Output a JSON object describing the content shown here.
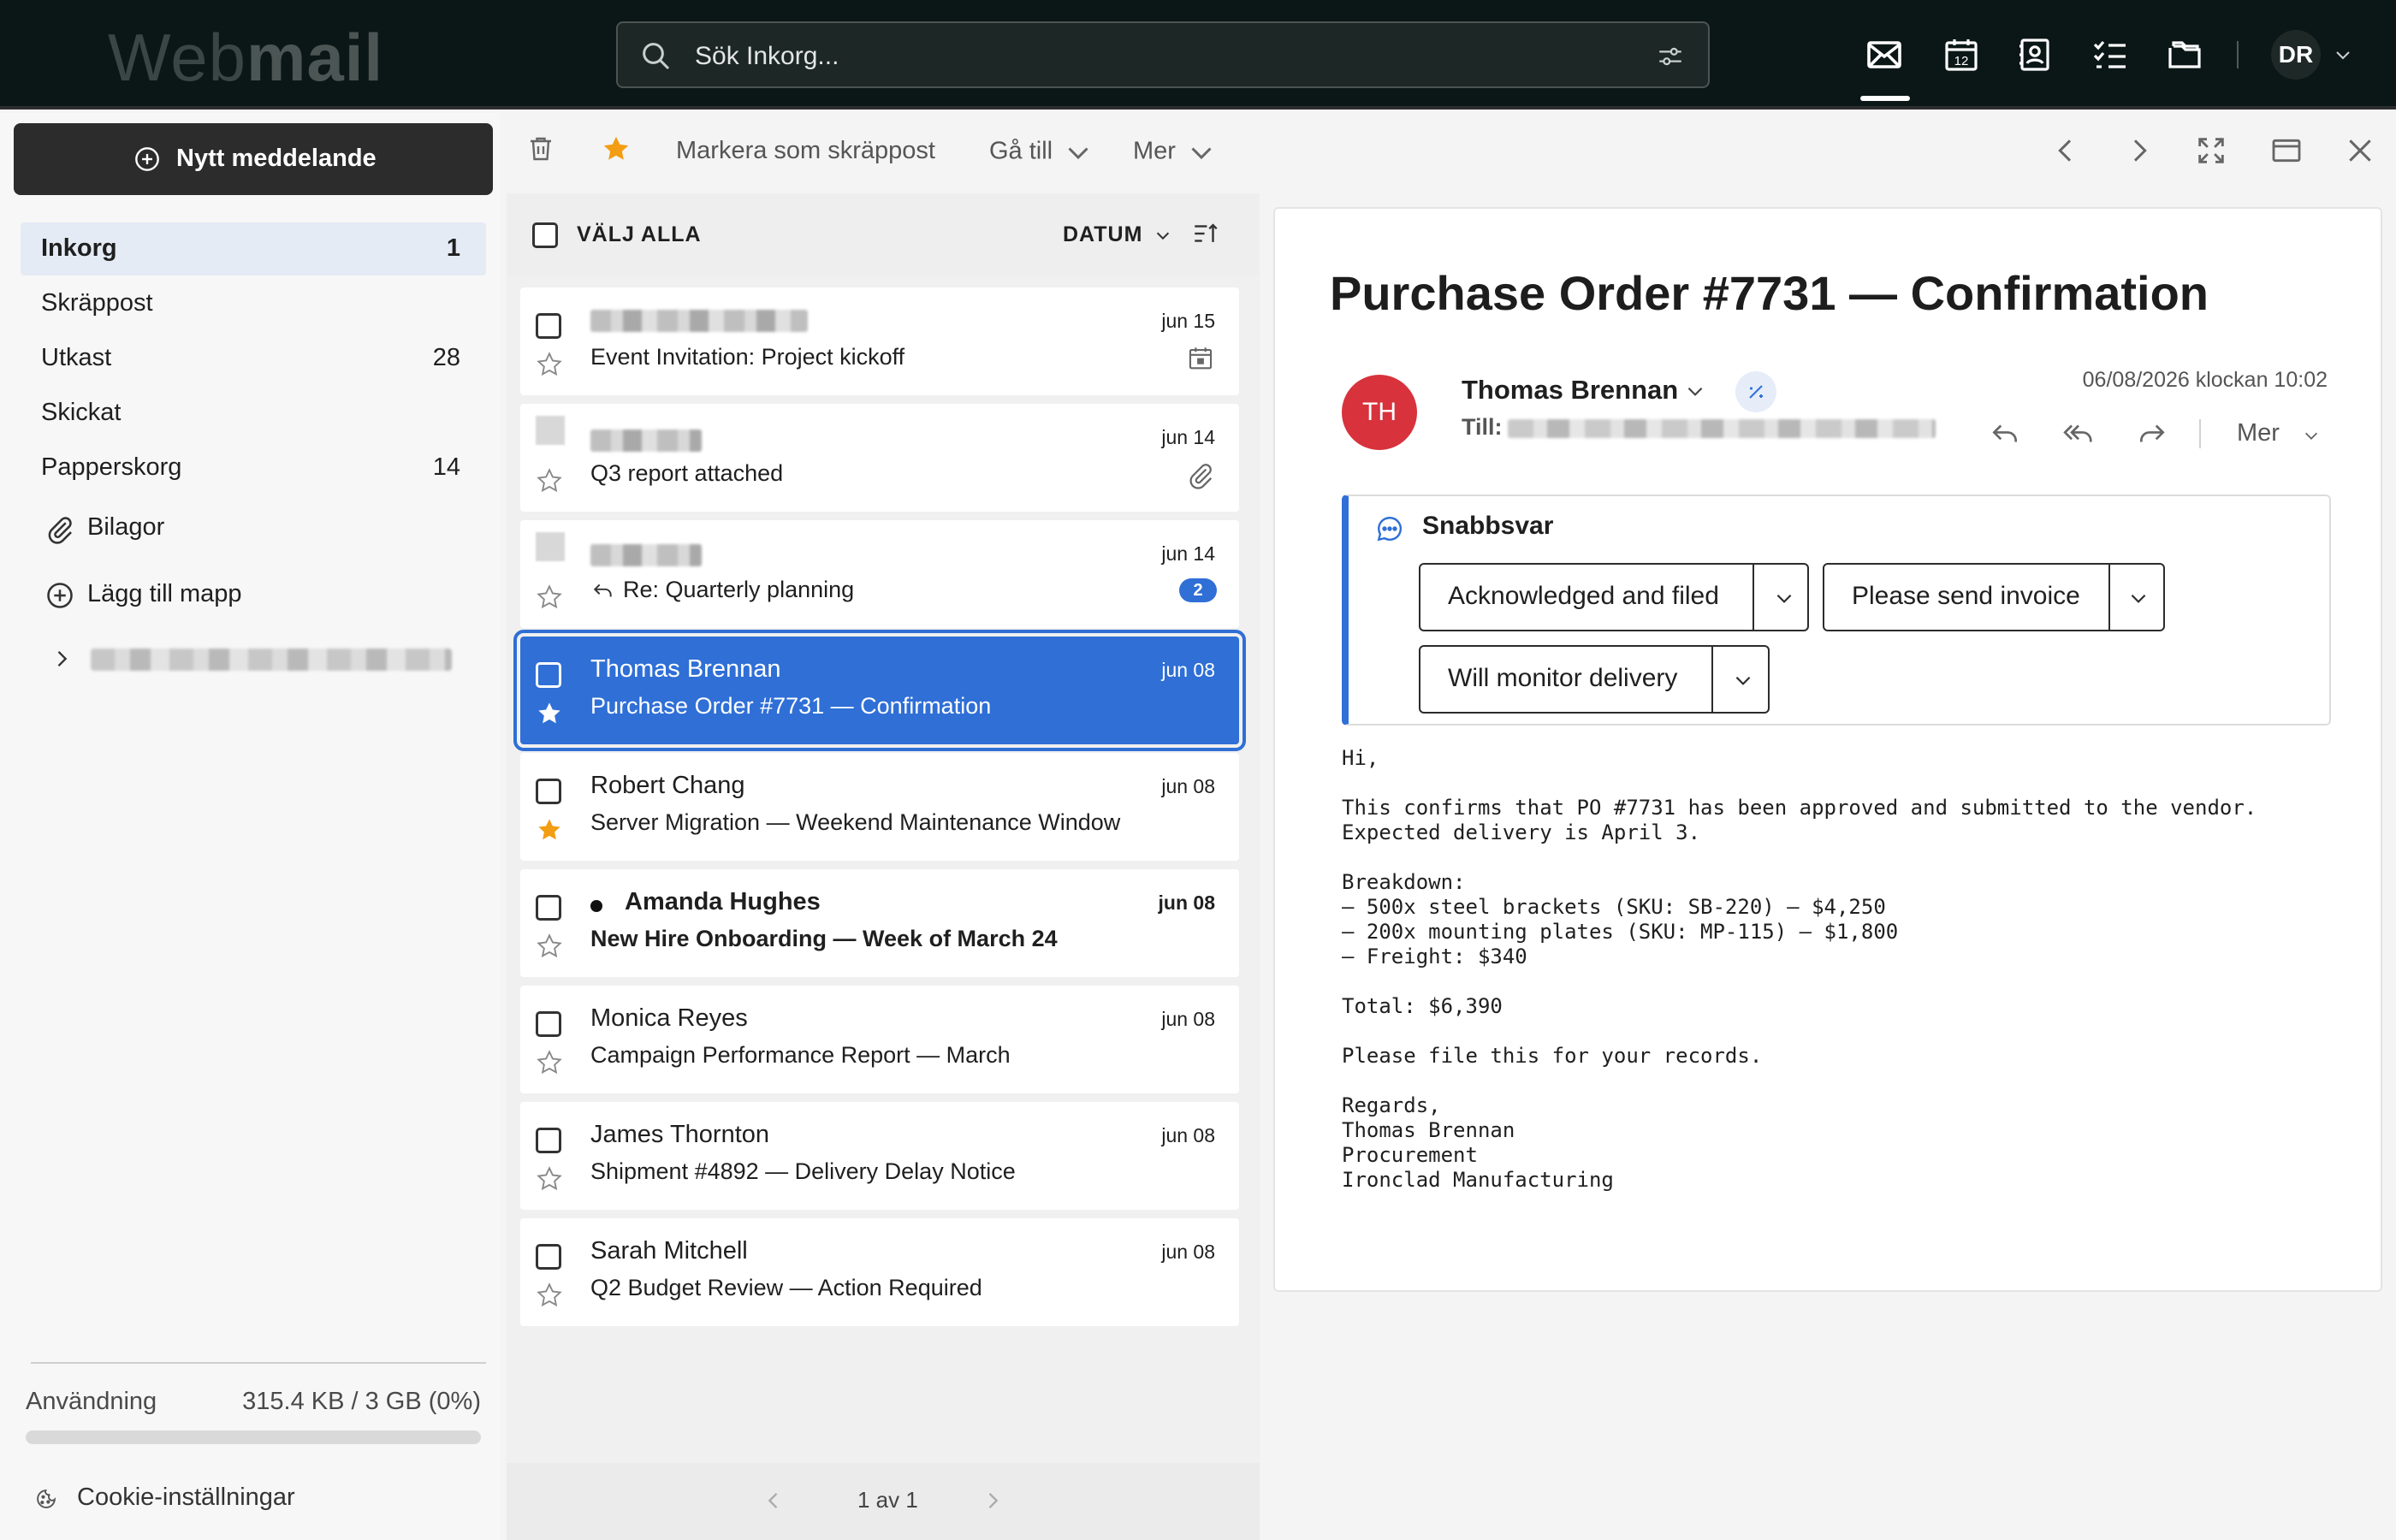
{
  "app": {
    "logo_light": "Web",
    "logo_bold": "mail",
    "search_placeholder": "Sök Inkorg...",
    "user_initials": "DR"
  },
  "top_nav": {
    "icons": [
      "mail-icon",
      "calendar-icon",
      "contacts-icon",
      "tasks-icon",
      "drive-icon"
    ],
    "calendar_day": "12",
    "active": "mail-icon"
  },
  "sidebar": {
    "compose_label": "Nytt meddelande",
    "folders": [
      {
        "name": "Inkorg",
        "count": "1",
        "active": true
      },
      {
        "name": "Skräppost",
        "count": ""
      },
      {
        "name": "Utkast",
        "count": "28"
      },
      {
        "name": "Skickat",
        "count": ""
      },
      {
        "name": "Papperskorg",
        "count": "14"
      }
    ],
    "attachments_label": "Bilagor",
    "add_folder_label": "Lägg till mapp",
    "usage_label": "Användning",
    "usage_value": "315.4 KB / 3 GB (0%)",
    "usage_fraction": 0,
    "cookie_label": "Cookie-inställningar"
  },
  "toolbar": {
    "spam_label": "Markera som skräppost",
    "goto_label": "Gå till",
    "more_label": "Mer"
  },
  "list": {
    "select_all_label": "VÄLJ ALLA",
    "sort_label": "DATUM",
    "pagination": "1 av 1",
    "messages": [
      {
        "sender": "",
        "sender_blurred": true,
        "subject": "Event Invitation: Project kickoff",
        "date": "jun 15",
        "starred": false,
        "extra": "calendar"
      },
      {
        "sender": "",
        "sender_blurred": true,
        "subject": "Q3 report attached",
        "date": "jun 14",
        "starred": false,
        "extra": "attachment"
      },
      {
        "sender": "",
        "sender_blurred": true,
        "subject": "Re: Quarterly planning",
        "date": "jun 14",
        "starred": false,
        "extra": "thread",
        "thread_count": "2",
        "replied": true
      },
      {
        "sender": "Thomas Brennan",
        "subject": "Purchase Order #7731 — Confirmation",
        "date": "jun 08",
        "starred": true,
        "selected": true
      },
      {
        "sender": "Robert Chang",
        "subject": "Server Migration — Weekend Maintenance Window",
        "date": "jun 08",
        "starred": true
      },
      {
        "sender": "Amanda Hughes",
        "subject": "New Hire Onboarding — Week of March 24",
        "date": "jun 08",
        "starred": false,
        "unread": true
      },
      {
        "sender": "Monica Reyes",
        "subject": "Campaign Performance Report — March",
        "date": "jun 08",
        "starred": false
      },
      {
        "sender": "James Thornton",
        "subject": "Shipment #4892 — Delivery Delay Notice",
        "date": "jun 08",
        "starred": false
      },
      {
        "sender": "Sarah Mitchell",
        "subject": "Q2 Budget Review — Action Required",
        "date": "jun 08",
        "starred": false
      }
    ]
  },
  "reader": {
    "subject": "Purchase Order #7731 — Confirmation",
    "avatar_initials": "TH",
    "avatar_color": "#d8323c",
    "from_name": "Thomas Brennan",
    "to_label": "Till:",
    "date": "06/08/2026 klockan 10:02",
    "more_label": "Mer",
    "quick_reply_title": "Snabbsvar",
    "quick_replies": [
      "Acknowledged and filed",
      "Please send invoice",
      "Will monitor delivery"
    ],
    "body": "Hi,\n\nThis confirms that PO #7731 has been approved and submitted to the vendor.\nExpected delivery is April 3.\n\nBreakdown:\n– 500x steel brackets (SKU: SB-220) – $4,250\n– 200x mounting plates (SKU: MP-115) – $1,800\n– Freight: $340\n\nTotal: $6,390\n\nPlease file this for your records.\n\nRegards,\nThomas Brennan\nProcurement\nIronclad Manufacturing"
  },
  "colors": {
    "accent": "#2f6fd6",
    "star": "#f29d12",
    "topbar": "#0b1716"
  }
}
